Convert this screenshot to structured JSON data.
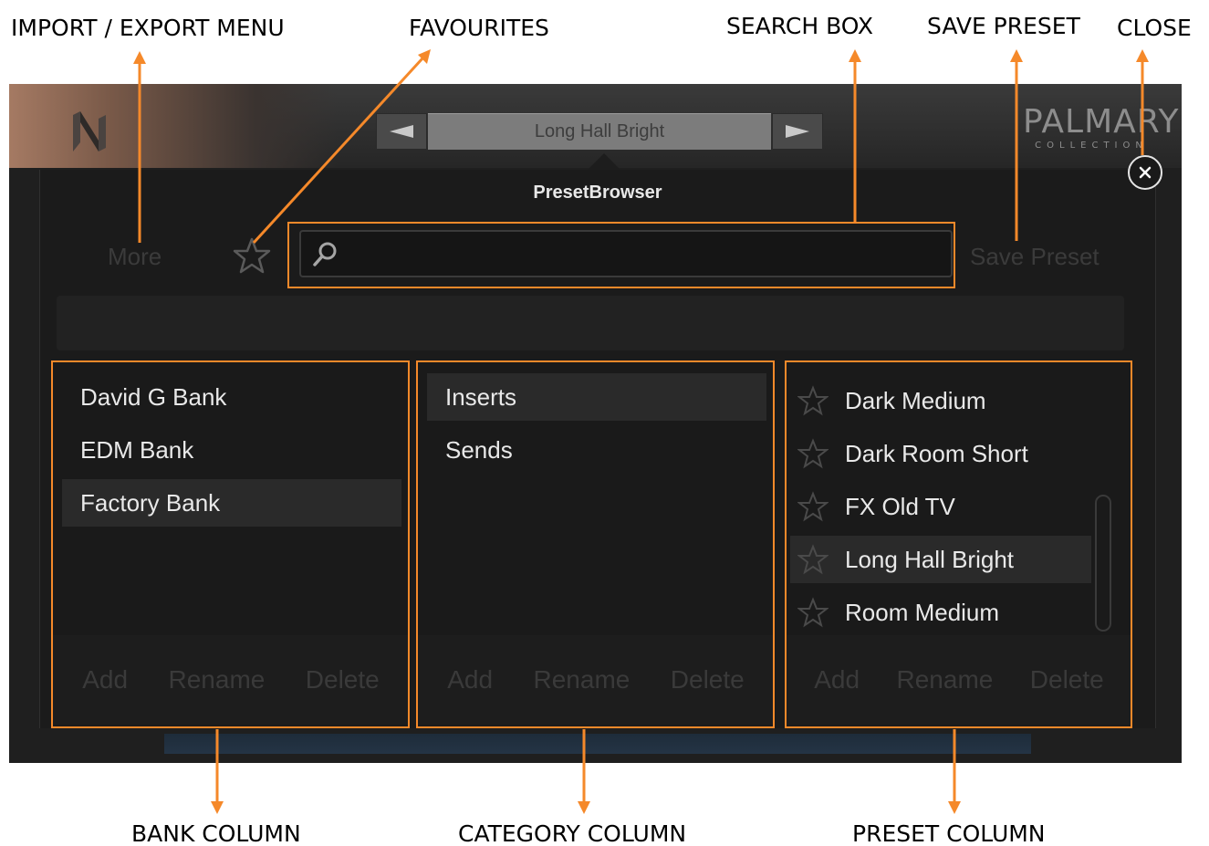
{
  "annotations": {
    "import_export": "IMPORT / EXPORT MENU",
    "favourites": "FAVOURITES",
    "search_box": "SEARCH BOX",
    "save_preset": "SAVE PRESET",
    "close": "CLOSE",
    "bank_column": "BANK COLUMN",
    "category_column": "CATEGORY COLUMN",
    "preset_column": "PRESET COLUMN"
  },
  "colors": {
    "annotation": "#f5892a"
  },
  "header": {
    "current_preset": "Long Hall Bright",
    "brand_name": "PALMARY",
    "brand_sub": "COLLECTION",
    "logo_icon": "n-logo-icon"
  },
  "browser": {
    "title": "PresetBrowser",
    "more_label": "More",
    "save_label": "Save Preset",
    "search_placeholder": ""
  },
  "banks": {
    "items": [
      "David G Bank",
      "EDM Bank",
      "Factory Bank"
    ],
    "selected": "Factory Bank",
    "footer": {
      "add": "Add",
      "rename": "Rename",
      "delete": "Delete"
    }
  },
  "categories": {
    "items": [
      "Inserts",
      "Sends"
    ],
    "selected": "Inserts",
    "footer": {
      "add": "Add",
      "rename": "Rename",
      "delete": "Delete"
    }
  },
  "presets": {
    "items": [
      "Dark Medium",
      "Dark Room Short",
      "FX Old TV",
      "Long Hall Bright",
      "Room Medium"
    ],
    "selected": "Long Hall Bright",
    "footer": {
      "add": "Add",
      "rename": "Rename",
      "delete": "Delete"
    }
  }
}
